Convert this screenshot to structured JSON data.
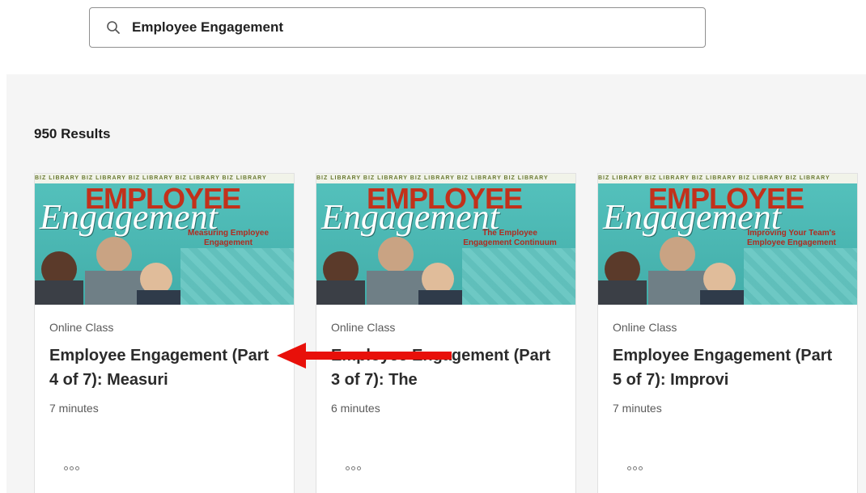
{
  "search": {
    "value": "Employee Engagement",
    "icon": "search-icon"
  },
  "results": {
    "count_label": "950 Results"
  },
  "cards": [
    {
      "type": "Online Class",
      "title": "Employee Engagement (Part 4 of 7): Measuri",
      "duration": "7 minutes",
      "thumb_big": "EMPLOYEE",
      "thumb_script": "Engagement",
      "thumb_sub": "Measuring Employee Engagement",
      "more_icon": "more-options-icon"
    },
    {
      "type": "Online Class",
      "title": "Employee Engagement (Part 3 of 7): The",
      "duration": "6 minutes",
      "thumb_big": "EMPLOYEE",
      "thumb_script": "Engagement",
      "thumb_sub": "The Employee Engagement Continuum",
      "more_icon": "more-options-icon"
    },
    {
      "type": "Online Class",
      "title": "Employee Engagement (Part 5 of 7): Improvi",
      "duration": "7 minutes",
      "thumb_big": "EMPLOYEE",
      "thumb_script": "Engagement",
      "thumb_sub": "Improving Your Team's Employee Engagement",
      "more_icon": "more-options-icon"
    }
  ],
  "thumb_strip": "BIZ LIBRARY BIZ LIBRARY BIZ LIBRARY BIZ LIBRARY BIZ LIBRARY",
  "colors": {
    "thumb_teal": "#4db7b3",
    "thumb_red": "#c2311b",
    "arrow_red": "#e8100a",
    "panel_bg": "#f5f5f5"
  }
}
